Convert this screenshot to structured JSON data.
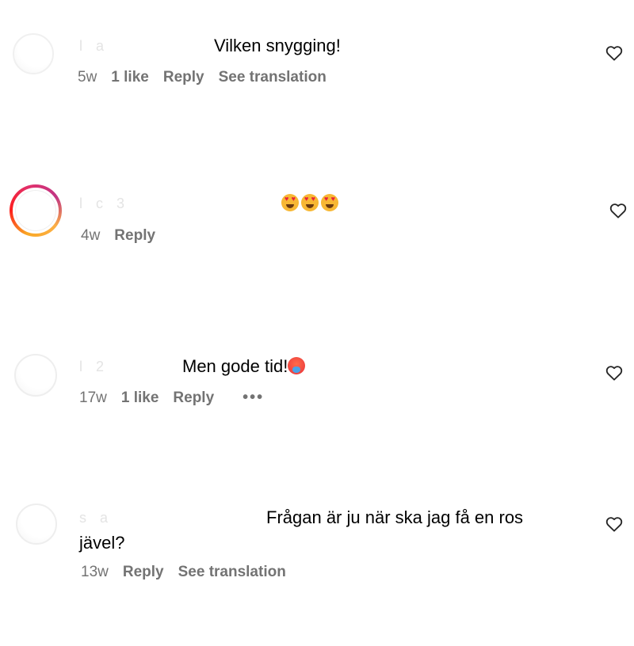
{
  "comments": [
    {
      "username": "l           a",
      "text": "Vilken snygging!",
      "time": "5w",
      "likes": "1 like",
      "reply": "Reply",
      "translate": "See translation",
      "avatar_ring": false
    },
    {
      "username": "l       c       3",
      "emojis": [
        "heart-eyes-emoji",
        "heart-eyes-emoji",
        "heart-eyes-emoji"
      ],
      "time": "4w",
      "reply": "Reply",
      "avatar_ring": true
    },
    {
      "username": "l        2",
      "text": "Men gode tid!",
      "emoji": "hot-face-emoji",
      "time": "17w",
      "likes": "1 like",
      "reply": "Reply",
      "more": "•••",
      "avatar_ring": false
    },
    {
      "username": "s                a",
      "text": "Frågan är ju när ska jag få en ros jävel?",
      "time": "13w",
      "reply": "Reply",
      "translate": "See translation",
      "avatar_ring": false
    }
  ],
  "colors": {
    "meta_gray": "#737373",
    "story_ring_start": "#f9a825",
    "story_ring_end": "#c13584"
  },
  "icons": {
    "like": "heart-outline-icon",
    "more": "ellipsis-icon"
  }
}
